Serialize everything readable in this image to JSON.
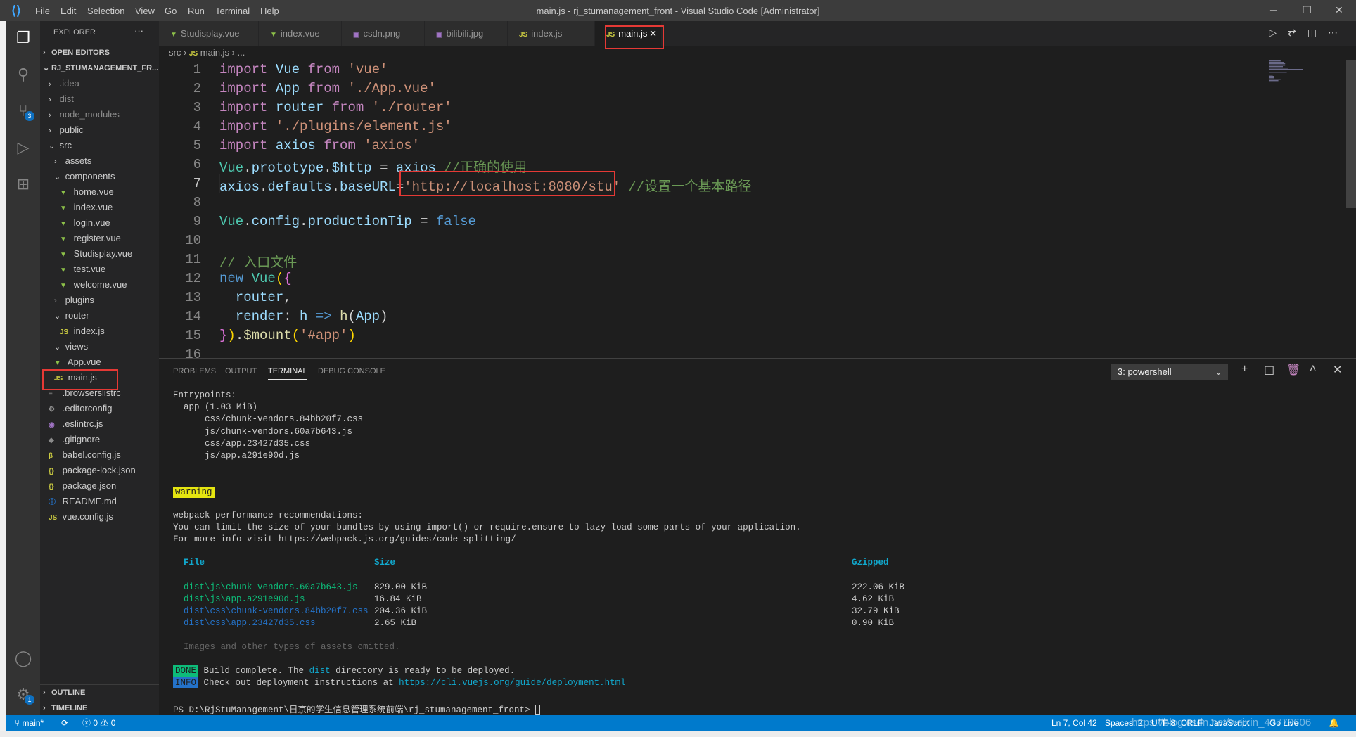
{
  "window": {
    "title": "main.js - rj_stumanagement_front - Visual Studio Code [Administrator]",
    "menu": [
      "File",
      "Edit",
      "Selection",
      "View",
      "Go",
      "Run",
      "Terminal",
      "Help"
    ]
  },
  "activity": {
    "scm_badge": "3",
    "settings_badge": "1"
  },
  "sidebar": {
    "title": "EXPLORER",
    "more": "···",
    "open_editors": "OPEN EDITORS",
    "project": "RJ_STUMANAGEMENT_FR...",
    "items": [
      {
        "label": ".idea",
        "type": "folder",
        "level": 1,
        "open": false,
        "dim": true
      },
      {
        "label": "dist",
        "type": "folder",
        "level": 1,
        "open": false,
        "dim": true
      },
      {
        "label": "node_modules",
        "type": "folder",
        "level": 1,
        "open": false,
        "dim": true
      },
      {
        "label": "public",
        "type": "folder",
        "level": 1,
        "open": false
      },
      {
        "label": "src",
        "type": "folder",
        "level": 1,
        "open": true
      },
      {
        "label": "assets",
        "type": "folder",
        "level": 2,
        "open": false
      },
      {
        "label": "components",
        "type": "folder",
        "level": 2,
        "open": true
      },
      {
        "label": "home.vue",
        "type": "vue",
        "level": 3
      },
      {
        "label": "index.vue",
        "type": "vue",
        "level": 3
      },
      {
        "label": "login.vue",
        "type": "vue",
        "level": 3
      },
      {
        "label": "register.vue",
        "type": "vue",
        "level": 3
      },
      {
        "label": "Studisplay.vue",
        "type": "vue",
        "level": 3
      },
      {
        "label": "test.vue",
        "type": "vue",
        "level": 3
      },
      {
        "label": "welcome.vue",
        "type": "vue",
        "level": 3
      },
      {
        "label": "plugins",
        "type": "folder",
        "level": 2,
        "open": false
      },
      {
        "label": "router",
        "type": "folder",
        "level": 2,
        "open": true
      },
      {
        "label": "index.js",
        "type": "js",
        "level": 3
      },
      {
        "label": "views",
        "type": "folder",
        "level": 2,
        "open": true
      },
      {
        "label": "App.vue",
        "type": "vue",
        "level": 2
      },
      {
        "label": "main.js",
        "type": "js",
        "level": 2
      },
      {
        "label": ".browserslistrc",
        "type": "lines",
        "level": 1
      },
      {
        "label": ".editorconfig",
        "type": "gear",
        "level": 1
      },
      {
        "label": ".eslintrc.js",
        "type": "eslint",
        "level": 1
      },
      {
        "label": ".gitignore",
        "type": "git",
        "level": 1
      },
      {
        "label": "babel.config.js",
        "type": "babel",
        "level": 1
      },
      {
        "label": "package-lock.json",
        "type": "json",
        "level": 1
      },
      {
        "label": "package.json",
        "type": "json",
        "level": 1
      },
      {
        "label": "README.md",
        "type": "info",
        "level": 1
      },
      {
        "label": "vue.config.js",
        "type": "js",
        "level": 1
      }
    ],
    "outline": "OUTLINE",
    "timeline": "TIMELINE"
  },
  "tabs": [
    {
      "label": "Studisplay.vue",
      "type": "vue"
    },
    {
      "label": "index.vue",
      "type": "vue"
    },
    {
      "label": "csdn.png",
      "type": "img"
    },
    {
      "label": "bilibili.jpg",
      "type": "img"
    },
    {
      "label": "index.js",
      "type": "js"
    },
    {
      "label": "main.js",
      "type": "js",
      "active": true
    }
  ],
  "breadcrumb": [
    "src",
    "main.js",
    "..."
  ],
  "code": [
    [
      [
        "import ",
        "kw"
      ],
      [
        "Vue ",
        "id"
      ],
      [
        "from ",
        "kw"
      ],
      [
        "'vue'",
        "st"
      ]
    ],
    [
      [
        "import ",
        "kw"
      ],
      [
        "App ",
        "id"
      ],
      [
        "from ",
        "kw"
      ],
      [
        "'./App.vue'",
        "st"
      ]
    ],
    [
      [
        "import ",
        "kw"
      ],
      [
        "router ",
        "id"
      ],
      [
        "from ",
        "kw"
      ],
      [
        "'./router'",
        "st"
      ]
    ],
    [
      [
        "import ",
        "kw"
      ],
      [
        "'./plugins/element.js'",
        "st"
      ]
    ],
    [
      [
        "import ",
        "kw"
      ],
      [
        "axios ",
        "id"
      ],
      [
        "from ",
        "kw"
      ],
      [
        "'axios'",
        "st"
      ]
    ],
    [
      [
        "Vue",
        "cls"
      ],
      [
        ".",
        "pl"
      ],
      [
        "prototype",
        "id"
      ],
      [
        ".",
        "pl"
      ],
      [
        "$http",
        "id"
      ],
      [
        " = ",
        "pl"
      ],
      [
        "axios",
        "id"
      ],
      [
        " //正确的使用",
        "cm"
      ]
    ],
    [
      [
        "axios",
        "id"
      ],
      [
        ".",
        "pl"
      ],
      [
        "defaults",
        "id"
      ],
      [
        ".",
        "pl"
      ],
      [
        "baseURL",
        "id"
      ],
      [
        "=",
        "pl"
      ],
      [
        "'http://localhost:8080/stu'",
        "st"
      ],
      [
        " //设置一个基本路径",
        "cm"
      ]
    ],
    [],
    [
      [
        "Vue",
        "cls"
      ],
      [
        ".",
        "pl"
      ],
      [
        "config",
        "id"
      ],
      [
        ".",
        "pl"
      ],
      [
        "productionTip",
        "id"
      ],
      [
        " = ",
        "pl"
      ],
      [
        "false",
        "bl"
      ]
    ],
    [],
    [
      [
        "// 入口文件",
        "cm"
      ]
    ],
    [
      [
        "new ",
        "bl"
      ],
      [
        "Vue",
        "cls"
      ],
      [
        "(",
        "br1"
      ],
      [
        "{",
        "br2"
      ]
    ],
    [
      [
        "  router",
        "id"
      ],
      [
        ",",
        "pl"
      ]
    ],
    [
      [
        "  render",
        "id"
      ],
      [
        ": ",
        "pl"
      ],
      [
        "h ",
        "id"
      ],
      [
        "=> ",
        "bl"
      ],
      [
        "h",
        "fn"
      ],
      [
        "(",
        "pl"
      ],
      [
        "App",
        "id"
      ],
      [
        ")",
        "pl"
      ]
    ],
    [
      [
        "}",
        "br2"
      ],
      [
        ")",
        "br1"
      ],
      [
        ".",
        "pl"
      ],
      [
        "$mount",
        "fn"
      ],
      [
        "(",
        "br1"
      ],
      [
        "'#app'",
        "st"
      ],
      [
        ")",
        "br1"
      ]
    ],
    []
  ],
  "editor": {
    "current_line": 7
  },
  "panel": {
    "tabs": [
      "PROBLEMS",
      "OUTPUT",
      "TERMINAL",
      "DEBUG CONSOLE"
    ],
    "active_tab": "TERMINAL",
    "terminal_select": "3: powershell"
  },
  "terminal": {
    "entrypoints": [
      "Entrypoints:",
      "  app (1.03 MiB)",
      "      css/chunk-vendors.84bb20f7.css",
      "      js/chunk-vendors.60a7b643.js",
      "      css/app.23427d35.css",
      "      js/app.a291e90d.js"
    ],
    "warning": "warning",
    "recommend": [
      "webpack performance recommendations:",
      "You can limit the size of your bundles by using import() or require.ensure to lazy load some parts of your application.",
      "For more info visit https://webpack.js.org/guides/code-splitting/"
    ],
    "table_headers": [
      "File",
      "Size",
      "Gzipped"
    ],
    "table_rows": [
      [
        "dist\\js\\chunk-vendors.60a7b643.js",
        "829.00 KiB",
        "222.06 KiB"
      ],
      [
        "dist\\js\\app.a291e90d.js",
        "16.84 KiB",
        "4.62 KiB"
      ],
      [
        "dist\\css\\chunk-vendors.84bb20f7.css",
        "204.36 KiB",
        "32.79 KiB"
      ],
      [
        "dist\\css\\app.23427d35.css",
        "2.65 KiB",
        "0.90 KiB"
      ]
    ],
    "omitted": "Images and other types of assets omitted.",
    "done_badge": "DONE",
    "done_text_a": "Build complete. The ",
    "done_text_dist": "dist",
    "done_text_b": " directory is ready to be deployed.",
    "info_badge": "INFO",
    "info_text": "Check out deployment instructions at ",
    "info_link": "https://cli.vuejs.org/guide/deployment.html",
    "prompt": "PS D:\\RjStuManagement\\日京的学生信息管理系统前端\\rj_stumanagement_front> "
  },
  "status": {
    "branch": "main*",
    "errors": "0",
    "warnings": "0",
    "position": "Ln 7, Col 42",
    "spaces": "Spaces: 2",
    "encoding": "UTF-8",
    "eol": "CRLF",
    "language": "JavaScript",
    "golive": "Go Live",
    "watermark": "https://blog.csdn.net/weixin_43779606"
  }
}
